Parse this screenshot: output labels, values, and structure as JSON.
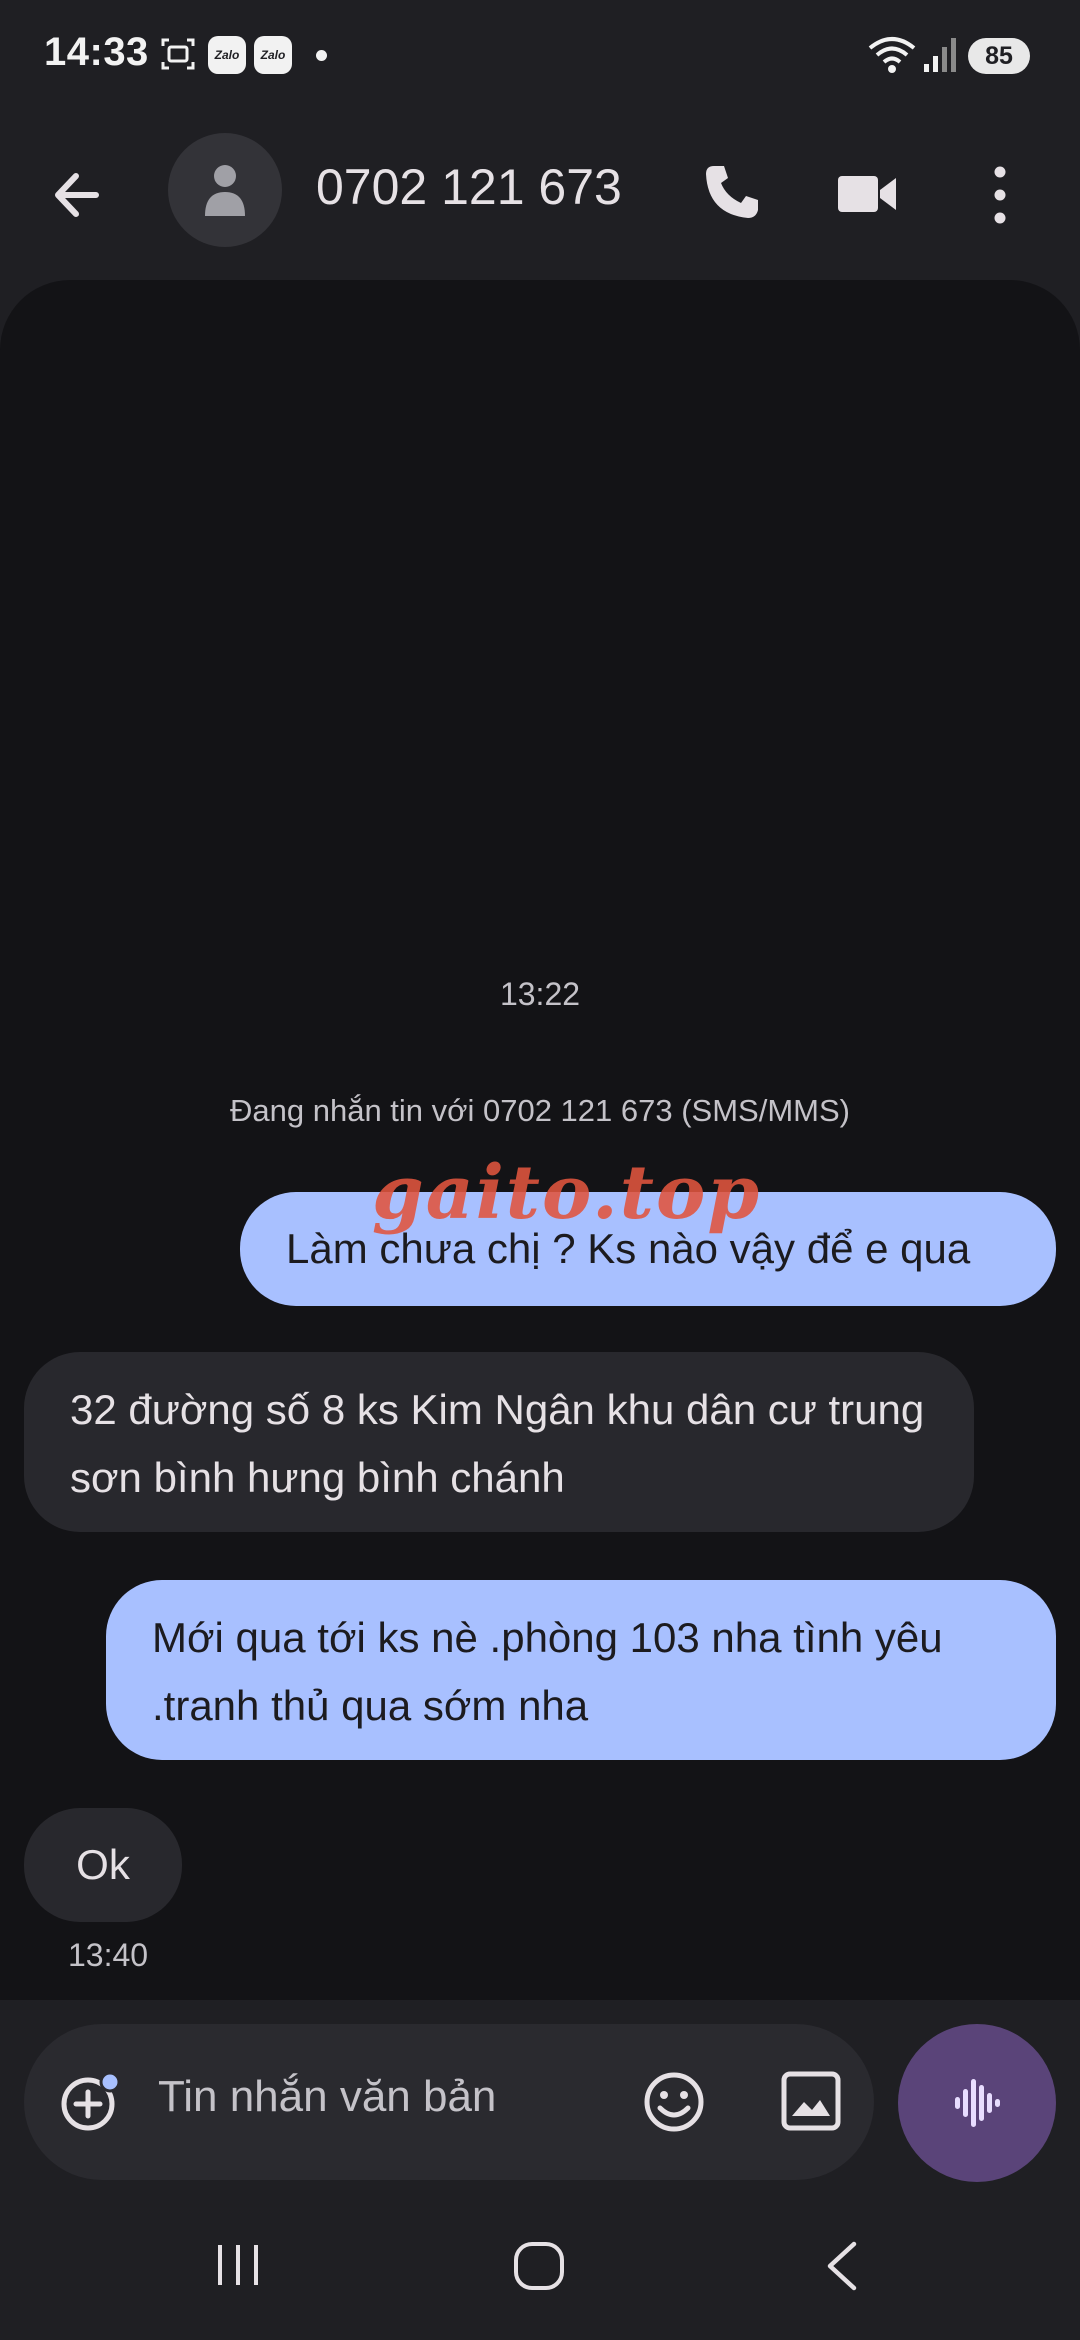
{
  "status_bar": {
    "time": "14:33",
    "notification_apps": [
      "Zalo",
      "Zalo"
    ],
    "battery": "85",
    "icons": [
      "screenshot-icon",
      "wifi-icon",
      "signal-icon",
      "battery-icon"
    ]
  },
  "header": {
    "title": "0702 121 673",
    "icons": [
      "back-arrow-icon",
      "person-icon",
      "phone-icon",
      "video-camera-icon",
      "more-vert-icon"
    ]
  },
  "conversation": {
    "start_time": "13:22",
    "info": "Đang nhắn tin với 0702 121 673 (SMS/MMS)",
    "watermark": "gaito.top",
    "messages": [
      {
        "direction": "outgoing",
        "text": "Làm chưa chị ? Ks nào vậy để e qua"
      },
      {
        "direction": "incoming",
        "text": "32 đường số 8 ks Kim Ngân khu dân cư trung sơn bình hưng bình chánh"
      },
      {
        "direction": "outgoing",
        "text": "Mới qua tới ks nè .phòng 103 nha tình yêu .tranh thủ qua sớm nha"
      },
      {
        "direction": "incoming",
        "text": "Ok"
      }
    ],
    "last_time": "13:40"
  },
  "composer": {
    "placeholder": "Tin nhắn văn bản",
    "icons": [
      "add-icon",
      "emoji-icon",
      "image-icon",
      "voice-waveform-icon"
    ]
  },
  "colors": {
    "background": "#1f1f23",
    "conversation_bg": "#131316",
    "outgoing_bubble": "#a8c0ff",
    "incoming_bubble": "#28282d",
    "voice_button": "#5a4479",
    "watermark": "#e2553e"
  }
}
